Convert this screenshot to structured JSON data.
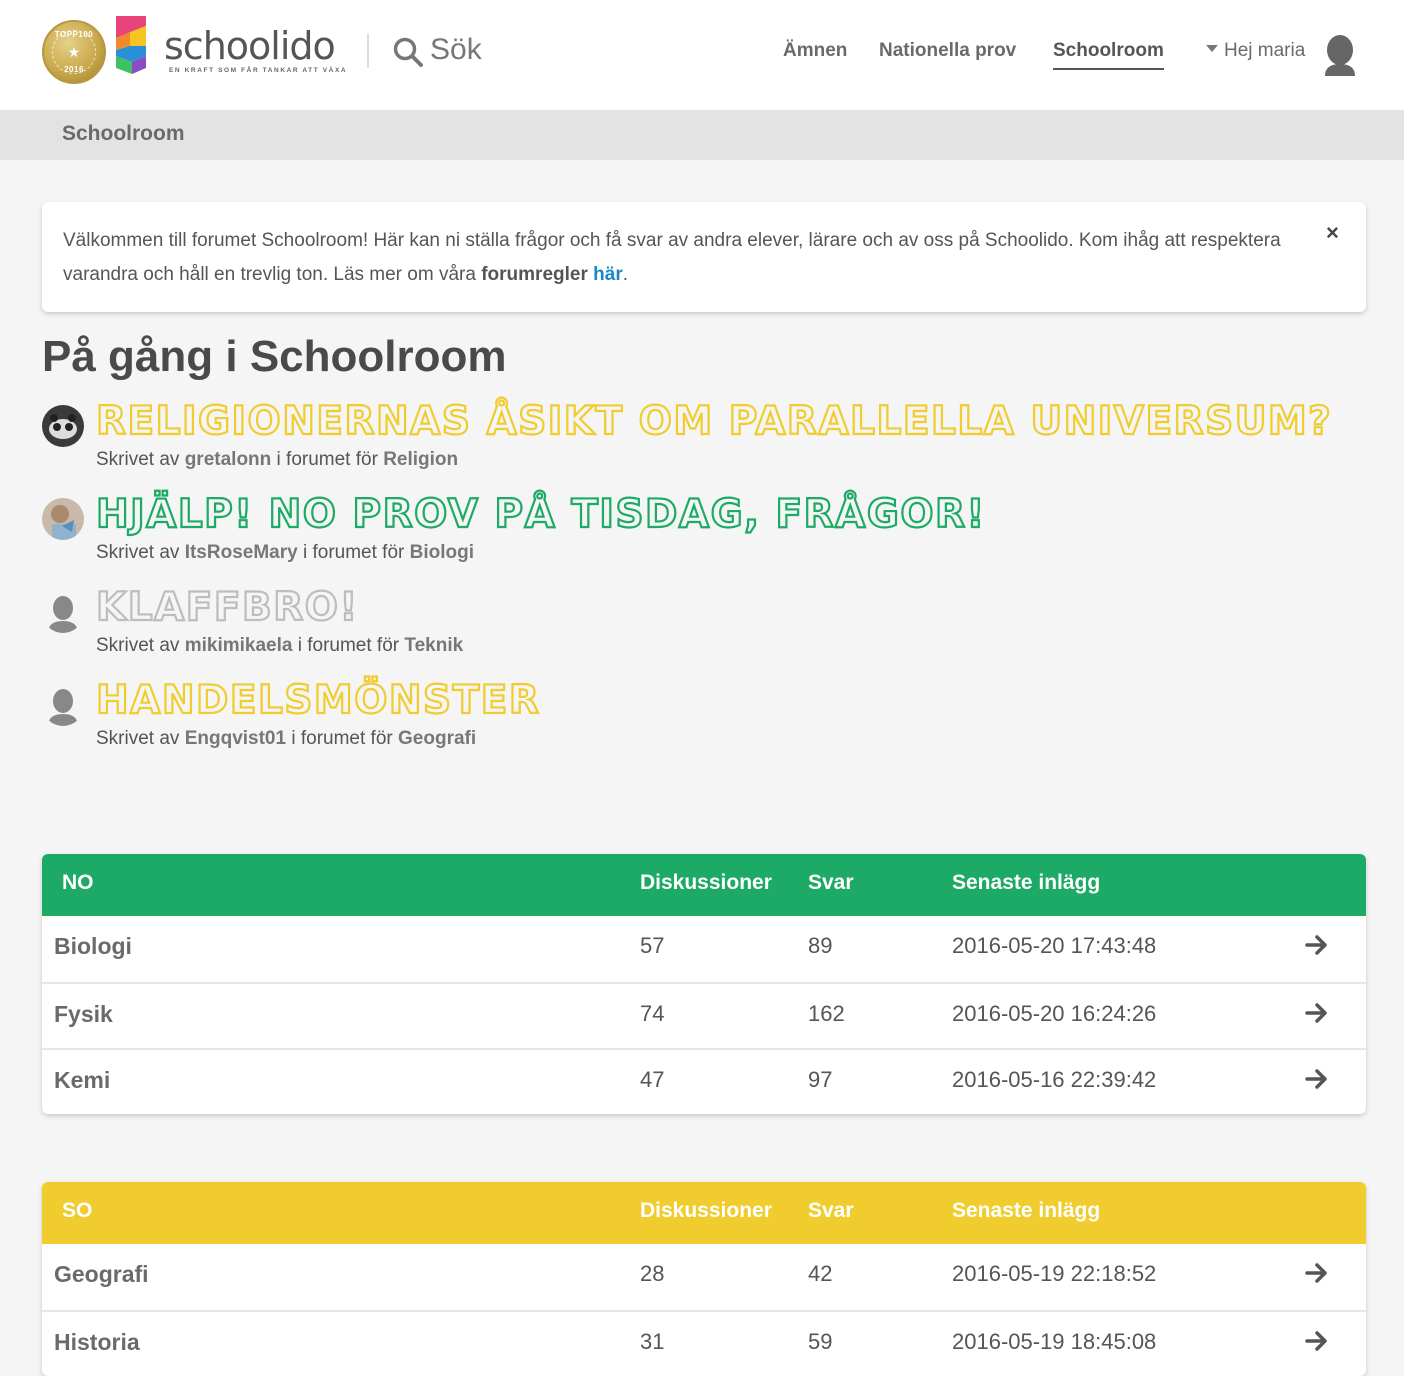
{
  "header": {
    "badge": {
      "top": "TOPP100",
      "bottom": "2016"
    },
    "brand": "schoolido",
    "tagline": "EN KRAFT SOM FÅR TANKAR ATT VÄXA",
    "search_label": "Sök",
    "nav": [
      "Ämnen",
      "Nationella prov",
      "Schoolroom"
    ],
    "active_nav": "Schoolroom",
    "user_label": "Hej maria"
  },
  "breadcrumb": "Schoolroom",
  "welcome": {
    "text_before": "Välkommen till forumet Schoolroom! Här kan ni ställa frågor och få svar av andra elever, lärare och av oss på Schoolido. Kom ihåg att respektera varandra och håll en trevlig ton. Läs mer om våra ",
    "rules_label": "forumregler",
    "link_label": "här",
    "text_after": ".",
    "close_label": "×"
  },
  "ongoing": {
    "title": "På gång i Schoolroom",
    "written_by": "Skrivet av",
    "in_forum": "i forumet för",
    "topics": [
      {
        "title": "Religionernas åsikt om parallella universum?",
        "author": "gretalonn",
        "forum": "Religion",
        "color": "#f0cc2e"
      },
      {
        "title": "Hjälp! NO prov på tisdag, frågor!",
        "author": "ItsRoseMary",
        "forum": "Biologi",
        "color": "#1daa66"
      },
      {
        "title": "Klaffbro!",
        "author": "mikimikaela",
        "forum": "Teknik",
        "color": "#bdbdbd"
      },
      {
        "title": "Handelsmönster",
        "author": "Engqvist01",
        "forum": "Geografi",
        "color": "#f0cc2e"
      }
    ]
  },
  "forums": [
    {
      "name": "NO",
      "color": "#1daa66",
      "headers": [
        "Diskussioner",
        "Svar",
        "Senaste inlägg"
      ],
      "rows": [
        {
          "name": "Biologi",
          "discussions": "57",
          "replies": "89",
          "latest": "2016-05-20 17:43:48"
        },
        {
          "name": "Fysik",
          "discussions": "74",
          "replies": "162",
          "latest": "2016-05-20 16:24:26"
        },
        {
          "name": "Kemi",
          "discussions": "47",
          "replies": "97",
          "latest": "2016-05-16 22:39:42"
        }
      ]
    },
    {
      "name": "SO",
      "color": "#f0cc2e",
      "headers": [
        "Diskussioner",
        "Svar",
        "Senaste inlägg"
      ],
      "rows": [
        {
          "name": "Geografi",
          "discussions": "28",
          "replies": "42",
          "latest": "2016-05-19 22:18:52"
        },
        {
          "name": "Historia",
          "discussions": "31",
          "replies": "59",
          "latest": "2016-05-19 18:45:08"
        }
      ]
    }
  ]
}
